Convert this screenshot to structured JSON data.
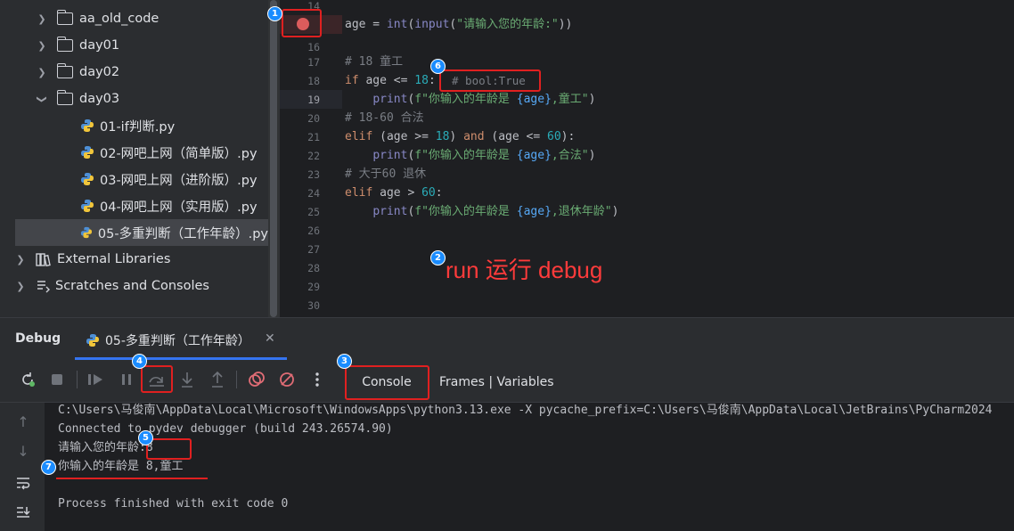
{
  "tree": {
    "items": [
      {
        "label": "aa_old_code",
        "kind": "folder",
        "expanded": false
      },
      {
        "label": "day01",
        "kind": "folder",
        "expanded": false
      },
      {
        "label": "day02",
        "kind": "folder",
        "expanded": false
      },
      {
        "label": "day03",
        "kind": "folder",
        "expanded": true
      },
      {
        "label": "01-if判断.py",
        "kind": "python-file"
      },
      {
        "label": "02-网吧上网（简单版）.py",
        "kind": "python-file"
      },
      {
        "label": "03-网吧上网（进阶版）.py",
        "kind": "python-file"
      },
      {
        "label": "04-网吧上网（实用版）.py",
        "kind": "python-file"
      },
      {
        "label": "05-多重判断（工作年龄）.py",
        "kind": "python-file",
        "selected": true
      },
      {
        "label": "External Libraries",
        "kind": "library"
      },
      {
        "label": "Scratches and Consoles",
        "kind": "scratches"
      }
    ]
  },
  "editor": {
    "line_numbers": [
      "14",
      "15",
      "16",
      "17",
      "18",
      "19",
      "20",
      "21",
      "22",
      "23",
      "24",
      "25",
      "26",
      "27",
      "28",
      "29",
      "30"
    ],
    "current_line": "19",
    "breakpoint_line": "15",
    "lines": {
      "l15": {
        "a": "age = ",
        "b": "int",
        "c": "(",
        "d": "input",
        "e": "(",
        "f": "\"请输入您的年龄:\"",
        "g": "))"
      },
      "l17": "# 18 童工",
      "l18": {
        "a": "if",
        "b": " age <= ",
        "c": "18",
        "d": ":"
      },
      "l18_hint": "# bool:True",
      "l19": {
        "a": "    ",
        "b": "print",
        "c": "(",
        "d": "f\"你输入的年龄是 ",
        "e": "{age}",
        "f": ",童工\"",
        "g": ")"
      },
      "l20": "# 18-60 合法",
      "l21": {
        "a": "elif",
        "b": " (age >= ",
        "c": "18",
        "d": ") ",
        "e": "and",
        "f": " (age <= ",
        "g": "60",
        "h": "):"
      },
      "l22": {
        "a": "    ",
        "b": "print",
        "c": "(",
        "d": "f\"你输入的年龄是 ",
        "e": "{age}",
        "f": ",合法\"",
        "g": ")"
      },
      "l23": "# 大于60 退休",
      "l24": {
        "a": "elif",
        "b": " age > ",
        "c": "60",
        "d": ":"
      },
      "l25": {
        "a": "    ",
        "b": "print",
        "c": "(",
        "d": "f\"你输入的年龄是 ",
        "e": "{age}",
        "f": ",退休年龄\"",
        "g": ")"
      }
    }
  },
  "annotation": {
    "text": "run 运行 debug",
    "color": "#ff3b3b"
  },
  "badges": [
    "1",
    "2",
    "3",
    "4",
    "5",
    "6",
    "7"
  ],
  "debug": {
    "title": "Debug",
    "tab_label": "05-多重判断（工作年龄）",
    "console_tab": "Console",
    "frames_tab": "Frames | Variables",
    "toolbar": [
      "rerun-icon",
      "stop-icon",
      "resume-icon",
      "pause-icon",
      "step-over-icon",
      "step-into-icon",
      "step-out-icon",
      "view-breakpoints-icon",
      "mute-breakpoints-icon",
      "more-icon"
    ]
  },
  "console": {
    "lines": [
      "C:\\Users\\马俊南\\AppData\\Local\\Microsoft\\WindowsApps\\python3.13.exe -X pycache_prefix=C:\\Users\\马俊南\\AppData\\Local\\JetBrains\\PyCharm2024",
      "Connected to pydev debugger (build 243.26574.90)",
      "请输入您的年龄:8",
      "你输入的年龄是 8,童工",
      "",
      "Process finished with exit code 0"
    ]
  },
  "colors": {
    "accent": "#3574f0",
    "annotation_red": "#e02020",
    "badge_blue": "#1a8cff",
    "breakpoint": "#db5c5c"
  }
}
